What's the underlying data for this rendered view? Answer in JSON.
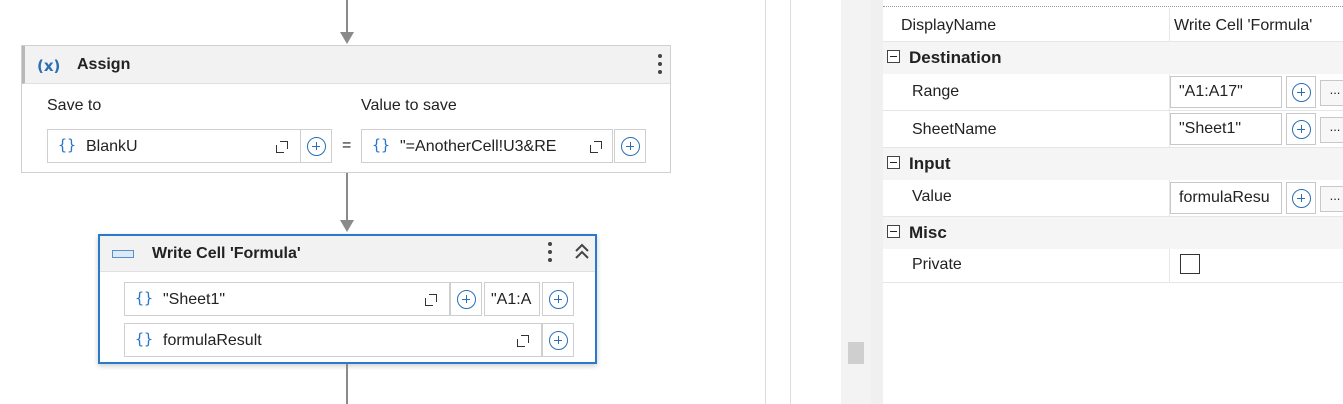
{
  "assign": {
    "title": "Assign",
    "icon_text": "(x)",
    "save_to_label": "Save to",
    "value_to_save_label": "Value to save",
    "save_to_value": "BlankU",
    "value_expression": "\"=AnotherCell!U3&RE",
    "equals": "="
  },
  "write_cell": {
    "title": "Write Cell 'Formula'",
    "sheet_value": "\"Sheet1\"",
    "range_value": "\"A1:A",
    "value_field": "formulaResult"
  },
  "properties": {
    "display_name_label": "DisplayName",
    "display_name_value": "Write Cell 'Formula'",
    "categories": {
      "destination": "Destination",
      "input": "Input",
      "misc": "Misc"
    },
    "range_label": "Range",
    "range_value": "\"A1:A17\"",
    "sheetname_label": "SheetName",
    "sheetname_value": "\"Sheet1\"",
    "value_label": "Value",
    "value_value": "formulaResu",
    "private_label": "Private",
    "ellipsis": "..."
  },
  "icons": {
    "brace": "{}",
    "expand": "expand-icon",
    "plus": "plus-circle-icon",
    "kebab": "more-vertical-icon",
    "collapse": "chevron-double-up-icon"
  }
}
